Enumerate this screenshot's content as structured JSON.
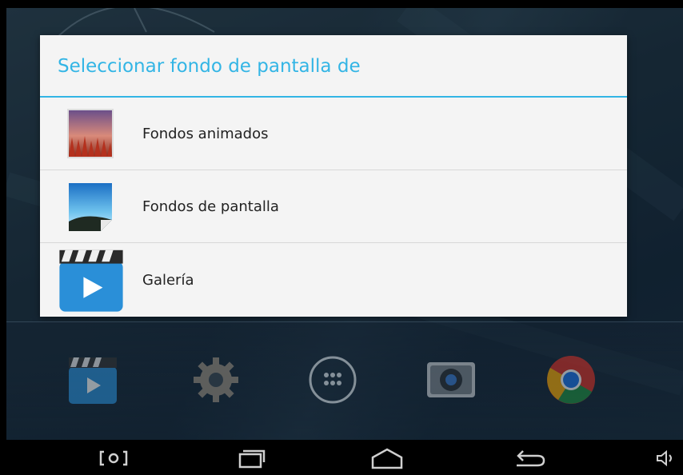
{
  "dialog": {
    "title": "Seleccionar fondo de pantalla de",
    "options": [
      {
        "label": "Fondos animados",
        "icon": "live-wallpapers-icon"
      },
      {
        "label": "Fondos de pantalla",
        "icon": "wallpapers-icon"
      },
      {
        "label": "Galería",
        "icon": "gallery-icon"
      }
    ]
  },
  "dock": {
    "icons": [
      "gallery-app-icon",
      "settings-icon",
      "app-drawer-icon",
      "camera-icon",
      "chrome-icon"
    ]
  },
  "navbar": {
    "buttons": [
      "screenshot-icon",
      "recent-apps-icon",
      "home-icon",
      "back-icon",
      "volume-icon"
    ]
  },
  "colors": {
    "accent": "#33b5e5",
    "dialog_bg": "#f4f4f4",
    "navbar_bg": "#000000"
  }
}
